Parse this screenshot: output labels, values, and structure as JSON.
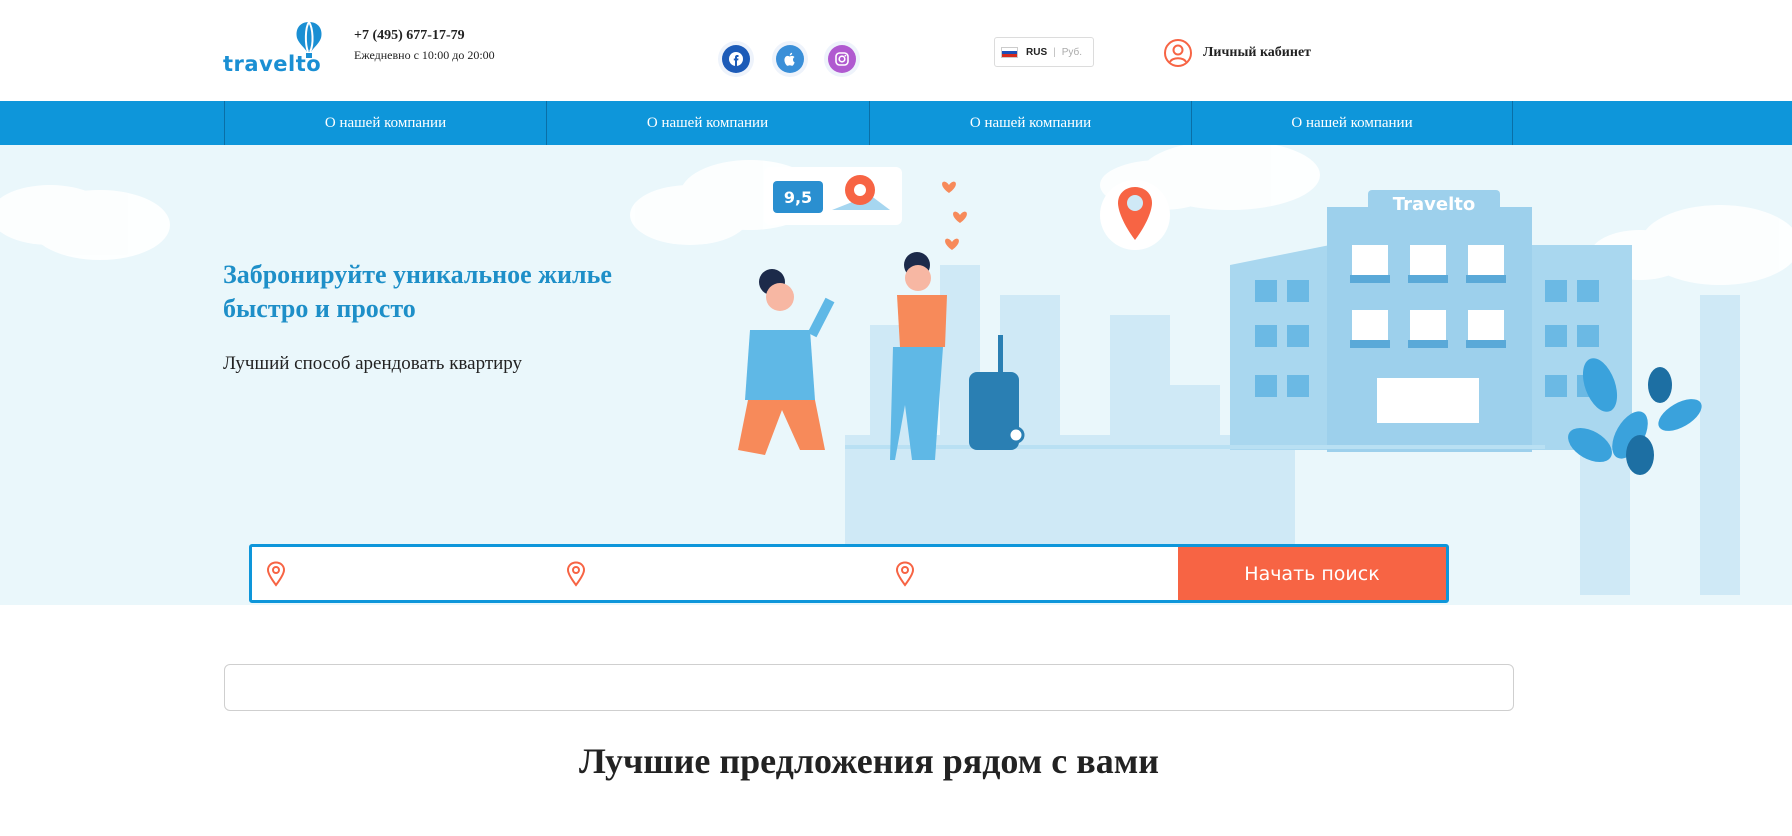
{
  "header": {
    "logo_text": "travelto",
    "phone": "+7 (495) 677-17-79",
    "hours": "Ежедневно с 10:00 до 20:00",
    "social": [
      {
        "name": "facebook-icon",
        "color": "#1c5bb8"
      },
      {
        "name": "apple-icon",
        "color": "#3a8fd8"
      },
      {
        "name": "instagram-icon",
        "color": "#b05ad0"
      }
    ],
    "language": "RUS",
    "currency": "Руб.",
    "account_label": "Личный кабинет"
  },
  "nav": {
    "items": [
      {
        "label": "О нашей компании"
      },
      {
        "label": "О нашей компании"
      },
      {
        "label": "О нашей компании"
      },
      {
        "label": "О нашей компании"
      }
    ]
  },
  "hero": {
    "title": "Забронируйте уникальное жилье быстро и просто",
    "subtitle": "Лучший способ арендовать квартиру",
    "rating_badge": "9,5",
    "building_sign": "Travelto"
  },
  "search": {
    "button_label": "Начать поиск",
    "fields": [
      {
        "value": ""
      },
      {
        "value": ""
      },
      {
        "value": ""
      }
    ]
  },
  "offers": {
    "title": "Лучшие предложения рядом с вами"
  },
  "colors": {
    "primary_blue": "#0e96da",
    "accent_orange": "#f76444",
    "hero_bg": "#eaf7fb"
  }
}
